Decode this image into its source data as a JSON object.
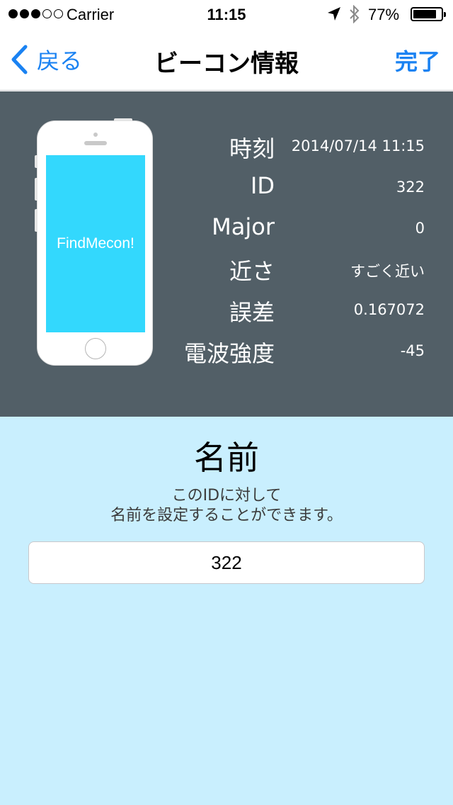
{
  "status_bar": {
    "carrier": "Carrier",
    "time": "11:15",
    "battery_percent": "77%",
    "battery_level": 0.77,
    "signal_strength": 3,
    "icons": [
      "location-icon",
      "bluetooth-icon",
      "battery-icon"
    ]
  },
  "nav": {
    "back_label": "戻る",
    "title": "ビーコン情報",
    "done_label": "完了"
  },
  "device": {
    "app_name": "FindMecon!",
    "screen_color": "#33d8fd"
  },
  "info": {
    "rows": [
      {
        "label": "時刻",
        "value": "2014/07/14 11:15"
      },
      {
        "label": "ID",
        "value": "322"
      },
      {
        "label": "Major",
        "value": "0"
      },
      {
        "label": "近さ",
        "value": "すごく近い"
      },
      {
        "label": "誤差",
        "value": "0.167072"
      },
      {
        "label": "電波強度",
        "value": "-45"
      }
    ]
  },
  "name_section": {
    "title": "名前",
    "description_line1": "このIDに対して",
    "description_line2": "名前を設定することができます。",
    "input_value": "322"
  },
  "colors": {
    "accent": "#1a82f2",
    "panel": "#525f67",
    "name_background": "#c9effe"
  }
}
